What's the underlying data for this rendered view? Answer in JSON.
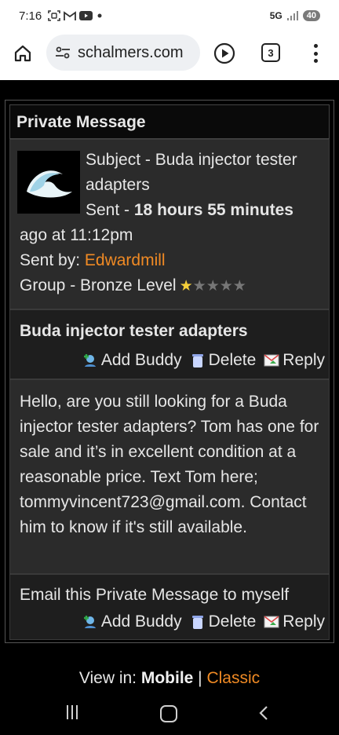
{
  "status_bar": {
    "time": "7:16",
    "network": "5G",
    "battery": "40",
    "notification_icons": [
      "screenshot-icon",
      "gmail-icon",
      "youtube-icon",
      "dot-icon"
    ]
  },
  "browser": {
    "url": "schalmers.com",
    "tab_count": "3"
  },
  "message": {
    "header": "Private Message",
    "subject_line": "Subject - Buda injector tester adapters",
    "sent_prefix": "Sent - ",
    "sent_bold": "18 hours 55 minutes",
    "sent_suffix": "ago at 11:12pm",
    "sent_by_label": "Sent by: ",
    "sender": "Edwardmill",
    "group": "Group - Bronze Level",
    "rating": 1,
    "rating_max": 5,
    "title": "Buda injector tester adapters",
    "body": "Hello, are you still looking for a Buda injector tester adapters? Tom has one for sale and it’s in excellent condition at a reasonable price. Text Tom here; tommyvincent723@gmail.com. Contact him to know if it's still available.",
    "email_link": "Email this Private Message to myself"
  },
  "actions": {
    "add_buddy": "Add Buddy",
    "delete": "Delete",
    "reply": "Reply"
  },
  "footer": {
    "view_in": "View in: ",
    "mobile": "Mobile",
    "separator": " | ",
    "classic": "Classic"
  },
  "colors": {
    "link_orange": "#f08a24",
    "cell_bg": "#2b2b2b",
    "row_bg": "#1e1e1e"
  }
}
